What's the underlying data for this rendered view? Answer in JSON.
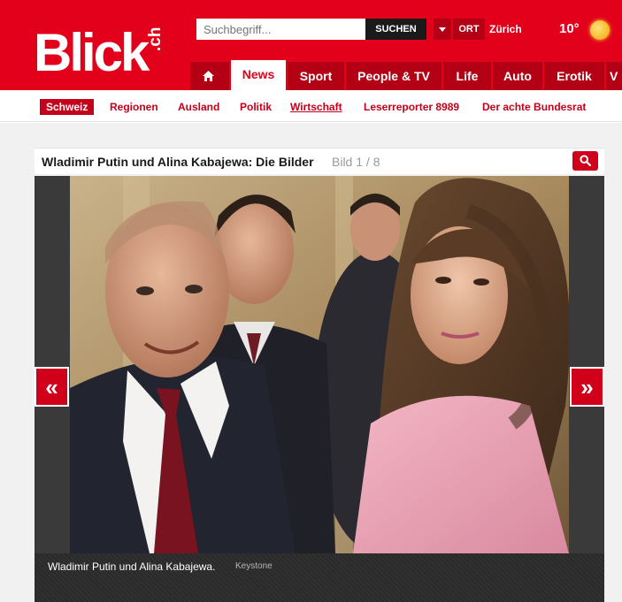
{
  "header": {
    "logo_main": "Blick",
    "logo_sup": ".ch",
    "search_placeholder": "Suchbegriff...",
    "search_button": "SUCHEN",
    "ort_label": "ORT",
    "ort_city": "Zürich",
    "temperature": "10°",
    "weather_icon": "sun-icon",
    "brand_color": "#e2001a"
  },
  "nav": {
    "home_icon": "home-icon",
    "tabs": [
      {
        "label": "News",
        "active": true
      },
      {
        "label": "Sport",
        "active": false
      },
      {
        "label": "People & TV",
        "active": false
      },
      {
        "label": "Life",
        "active": false
      },
      {
        "label": "Auto",
        "active": false
      },
      {
        "label": "Erotik",
        "active": false
      },
      {
        "label": "V",
        "active": false
      }
    ]
  },
  "subnav": {
    "items": [
      {
        "label": "Schweiz",
        "active": true
      },
      {
        "label": "Regionen"
      },
      {
        "label": "Ausland"
      },
      {
        "label": "Politik"
      },
      {
        "label": "Wirtschaft"
      },
      {
        "label": "Leserreporter 8989"
      },
      {
        "label": "Der achte Bundesrat"
      }
    ]
  },
  "gallery": {
    "title": "Wladimir Putin und Alina Kabajewa: Die Bilder",
    "counter": "Bild 1 / 8",
    "zoom_icon": "search-icon",
    "prev_label": "«",
    "next_label": "»",
    "caption": "Wladimir Putin und Alina Kabajewa.",
    "credit": "Keystone"
  }
}
